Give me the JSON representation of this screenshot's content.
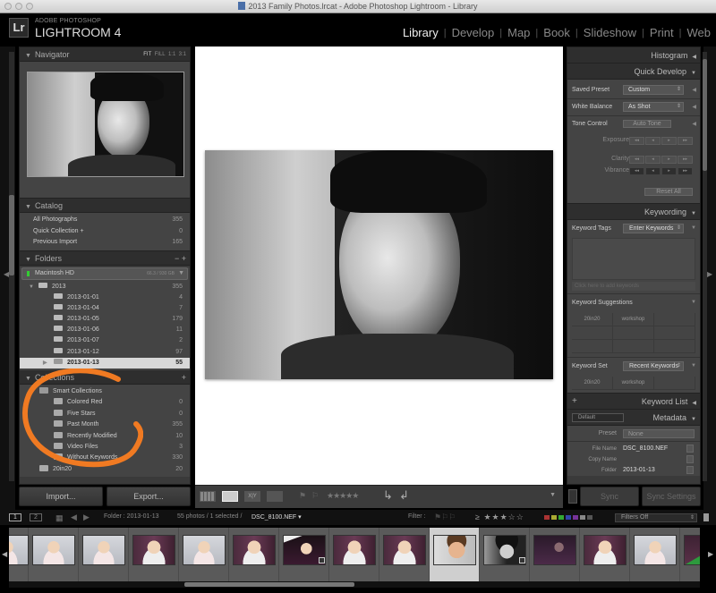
{
  "window": {
    "title": "2013 Family Photos.lrcat - Adobe Photoshop Lightroom - Library"
  },
  "identity_plate": {
    "logo": "Lr",
    "product_line": "ADOBE PHOTOSHOP",
    "product_name": "LIGHTROOM 4"
  },
  "modules": [
    {
      "label": "Library",
      "active": true
    },
    {
      "label": "Develop",
      "active": false
    },
    {
      "label": "Map",
      "active": false
    },
    {
      "label": "Book",
      "active": false
    },
    {
      "label": "Slideshow",
      "active": false
    },
    {
      "label": "Print",
      "active": false
    },
    {
      "label": "Web",
      "active": false
    }
  ],
  "left_panel": {
    "navigator": {
      "title": "Navigator",
      "zoom_options": [
        "FIT",
        "FILL",
        "1:1",
        "3:1"
      ]
    },
    "catalog": {
      "title": "Catalog",
      "items": [
        {
          "label": "All Photographs",
          "count": "355"
        },
        {
          "label": "Quick Collection +",
          "count": "0"
        },
        {
          "label": "Previous Import",
          "count": "165"
        }
      ]
    },
    "folders": {
      "title": "Folders",
      "actions": "− +",
      "drive": {
        "label": "Macintosh HD",
        "capacity": "66.3 / 930 GB"
      },
      "root": {
        "label": "2013",
        "count": "355"
      },
      "items": [
        {
          "label": "2013-01-01",
          "count": "4"
        },
        {
          "label": "2013-01-04",
          "count": "7"
        },
        {
          "label": "2013-01-05",
          "count": "179"
        },
        {
          "label": "2013-01-06",
          "count": "11"
        },
        {
          "label": "2013-01-07",
          "count": "2"
        },
        {
          "label": "2013-01-12",
          "count": "97"
        },
        {
          "label": "2013-01-13",
          "count": "55",
          "selected": true
        }
      ]
    },
    "collections": {
      "title": "Collections",
      "action": "+",
      "group": "Smart Collections",
      "items": [
        {
          "label": "Colored Red",
          "count": "0"
        },
        {
          "label": "Five Stars",
          "count": "0"
        },
        {
          "label": "Past Month",
          "count": "355"
        },
        {
          "label": "Recently Modified",
          "count": "10"
        },
        {
          "label": "Video Files",
          "count": "3"
        },
        {
          "label": "Without Keywords",
          "count": "330"
        }
      ],
      "other": {
        "label": "20in20",
        "count": "20"
      }
    },
    "import_label": "Import...",
    "export_label": "Export..."
  },
  "right_panel": {
    "histogram": {
      "title": "Histogram"
    },
    "quick_develop": {
      "title": "Quick Develop",
      "saved_preset": {
        "label": "Saved Preset",
        "value": "Custom"
      },
      "white_balance": {
        "label": "White Balance",
        "value": "As Shot"
      },
      "tone_control": {
        "label": "Tone Control",
        "button": "Auto Tone"
      },
      "exposure": {
        "label": "Exposure",
        "steps": [
          "◂◂",
          "◂",
          "▸",
          "▸▸"
        ]
      },
      "clarity": {
        "label": "Clarity",
        "steps": [
          "◂◂",
          "◂",
          "▸",
          "▸▸"
        ]
      },
      "vibrance": {
        "label": "Vibrance",
        "steps": [
          "◂◂",
          "◂",
          "▸",
          "▸▸"
        ]
      },
      "reset": "Reset All"
    },
    "keywording": {
      "title": "Keywording",
      "tags_label": "Keyword Tags",
      "tags_mode": "Enter Keywords",
      "hint": "Click here to add keywords",
      "suggestions_label": "Keyword Suggestions",
      "suggestions": [
        "20in20",
        "workshop",
        "",
        "",
        "",
        "",
        "",
        "",
        ""
      ],
      "set_label": "Keyword Set",
      "set_value": "Recent Keywords",
      "set_items": [
        "20in20",
        "workshop",
        ""
      ]
    },
    "keyword_list": {
      "title": "Keyword List",
      "action": "+"
    },
    "metadata": {
      "title": "Metadata",
      "view_preset": "Default",
      "preset_label": "Preset",
      "preset_value": "None",
      "fields": [
        {
          "key": "File Name",
          "value": "DSC_8100.NEF"
        },
        {
          "key": "Copy Name",
          "value": ""
        },
        {
          "key": "Folder",
          "value": "2013-01-13"
        }
      ]
    },
    "sync_label": "Sync",
    "sync_settings_label": "Sync Settings"
  },
  "toolbar": {
    "rating_stars": "★★★★★"
  },
  "filmstrip_bar": {
    "screen1": "1",
    "screen2": "2",
    "folder": "Folder : 2013-01-13",
    "status": "55 photos / 1 selected /",
    "filename": "DSC_8100.NEF ▾",
    "filter_label": "Filter :",
    "rating_filter": "≥ ★★★☆☆",
    "filter_value": "Filters Off",
    "color_labels": [
      "#a33",
      "#aa3",
      "#3a3",
      "#34a",
      "#739",
      "#888",
      "#555"
    ]
  },
  "filmstrip": {
    "selected_index": 9,
    "thumbs": [
      "toddler-white",
      "toddler-white",
      "toddler-white",
      "toddler-purple",
      "toddler-white",
      "toddler-purple",
      "toddler-arms",
      "toddler-purple",
      "toddler-purple",
      "boy-color",
      "boy-bw",
      "dark-purple",
      "toddler-purple",
      "toddler-white",
      "toddler-green"
    ]
  },
  "colors": {
    "annotation": "#f07a22",
    "panel_bg": "#3a3a3a",
    "selected_folder": "#d8d8d8"
  }
}
